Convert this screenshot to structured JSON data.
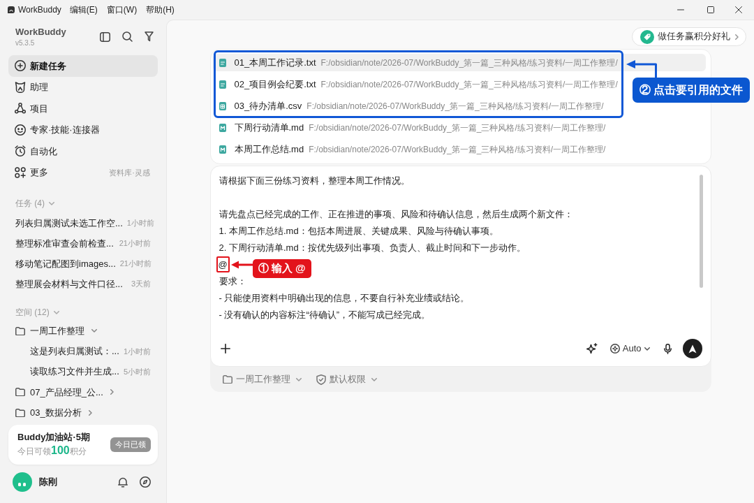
{
  "title_bar": {
    "app_name": "WorkBuddy",
    "menus": [
      "编辑(E)",
      "窗口(W)",
      "帮助(H)"
    ]
  },
  "sidebar": {
    "app_name": "WorkBuddy",
    "version": "v5.3.5",
    "nav": [
      {
        "label": "新建任务",
        "selected": true
      },
      {
        "label": "助理",
        "selected": false
      },
      {
        "label": "项目",
        "selected": false
      },
      {
        "label": "专家·技能·连接器",
        "selected": false
      },
      {
        "label": "自动化",
        "selected": false
      },
      {
        "label": "更多",
        "selected": false,
        "hint": "资料库·灵感"
      }
    ],
    "tasks": {
      "title": "任务 (4)",
      "expanded": true,
      "items": [
        {
          "title": "列表归属测试未选工作空...",
          "time": "1小时前"
        },
        {
          "title": "整理标准审查会前检查...",
          "time": "21小时前"
        },
        {
          "title": "移动笔记配图到images...",
          "time": "21小时前"
        },
        {
          "title": "整理展会材料与文件口径...",
          "time": "3天前"
        }
      ]
    },
    "spaces": {
      "title": "空间 (12)",
      "expanded": true,
      "items": [
        {
          "name": "一周工作整理",
          "expanded": true,
          "children": [
            {
              "title": "这是列表归属测试：...",
              "time": "1小时前"
            },
            {
              "title": "读取练习文件并生成...",
              "time": "5小时前"
            }
          ]
        },
        {
          "name": "07_产品经理_公...",
          "expanded": false
        },
        {
          "name": "03_数据分析",
          "expanded": false
        }
      ]
    },
    "promo_card": {
      "title": "Buddy加油站·5期",
      "text": "今日可领**100**积分",
      "button": {
        "label": "今日已领",
        "disabled": true
      }
    },
    "user": {
      "name": "陈刚"
    }
  },
  "main": {
    "reward_button": "做任务赢积分好礼",
    "file_picker": {
      "items": [
        {
          "name": "01_本周工作记录.txt",
          "path": "F:/obsidian/note/2026-07/WorkBuddy_第一篇_三种风格/练习资料/一周工作整理/",
          "kind": "txt",
          "selected": true,
          "boxed": true
        },
        {
          "name": "02_项目例会纪要.txt",
          "path": "F:/obsidian/note/2026-07/WorkBuddy_第一篇_三种风格/练习资料/一周工作整理/",
          "kind": "txt",
          "selected": false,
          "boxed": true
        },
        {
          "name": "03_待办清单.csv",
          "path": "F:/obsidian/note/2026-07/WorkBuddy_第一篇_三种风格/练习资料/一周工作整理/",
          "kind": "csv",
          "selected": false,
          "boxed": true
        },
        {
          "name": "下周行动清单.md",
          "path": "F:/obsidian/note/2026-07/WorkBuddy_第一篇_三种风格/练习资料/一周工作整理/",
          "kind": "md",
          "selected": false,
          "boxed": false
        },
        {
          "name": "本周工作总结.md",
          "path": "F:/obsidian/note/2026-07/WorkBuddy_第一篇_三种风格/练习资料/一周工作整理/",
          "kind": "md",
          "selected": false,
          "boxed": false
        }
      ],
      "callout": "② 点击要引用的文件"
    },
    "composer": {
      "paragraphs": [
        [
          {
            "text": "请根据下面三份练习资料，整理本周工作情况。",
            "boxed": false
          }
        ],
        [
          {
            "text": "请先盘点已经完成的工作、正在推进的事项、风险和待确认信息，然后生成两个新文件：",
            "boxed": false
          },
          {
            "text": "1. 本周工作总结.md：包括本周进展、关键成果、风险与待确认事项。",
            "boxed": false
          },
          {
            "text": "2. 下周行动清单.md：按优先级列出事项、负责人、截止时间和下一步动作。",
            "boxed": false
          },
          {
            "text": "@",
            "boxed": true
          },
          {
            "text": "要求：",
            "boxed": false
          },
          {
            "text": "- 只能使用资料中明确出现的信息，不要自行补充业绩或结论。",
            "boxed": false
          },
          {
            "text": "- 没有确认的内容标注“待确认”，不能写成已经完成。",
            "boxed": false
          }
        ]
      ],
      "callout": "① 输入 @",
      "model": "Auto"
    },
    "footer": {
      "workspace": "一周工作整理",
      "permission": "默认权限"
    }
  }
}
